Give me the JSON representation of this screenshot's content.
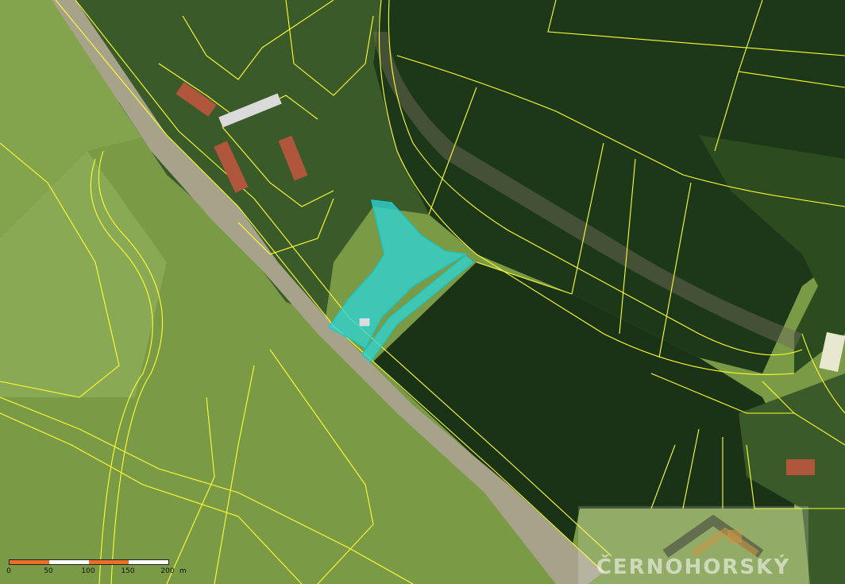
{
  "map": {
    "type": "cadastral-aerial",
    "colors": {
      "field_light": "#7ea04a",
      "field_dark": "#1f3a1a",
      "forest": "#2e4a22",
      "road": "#a9a58f",
      "parcel_line": "#ffff33",
      "highlight_fill": "#2fd3d3",
      "highlight_stroke": "#19c7c7"
    }
  },
  "scale_bar": {
    "ticks": [
      "0",
      "50",
      "100",
      "150",
      "200"
    ],
    "unit": "m",
    "colors": [
      "#e8702a",
      "#ffffff",
      "#e8702a",
      "#ffffff"
    ]
  },
  "watermark": {
    "text": "ČERNOHORSKÝ",
    "icon": "house-roof-icon"
  }
}
